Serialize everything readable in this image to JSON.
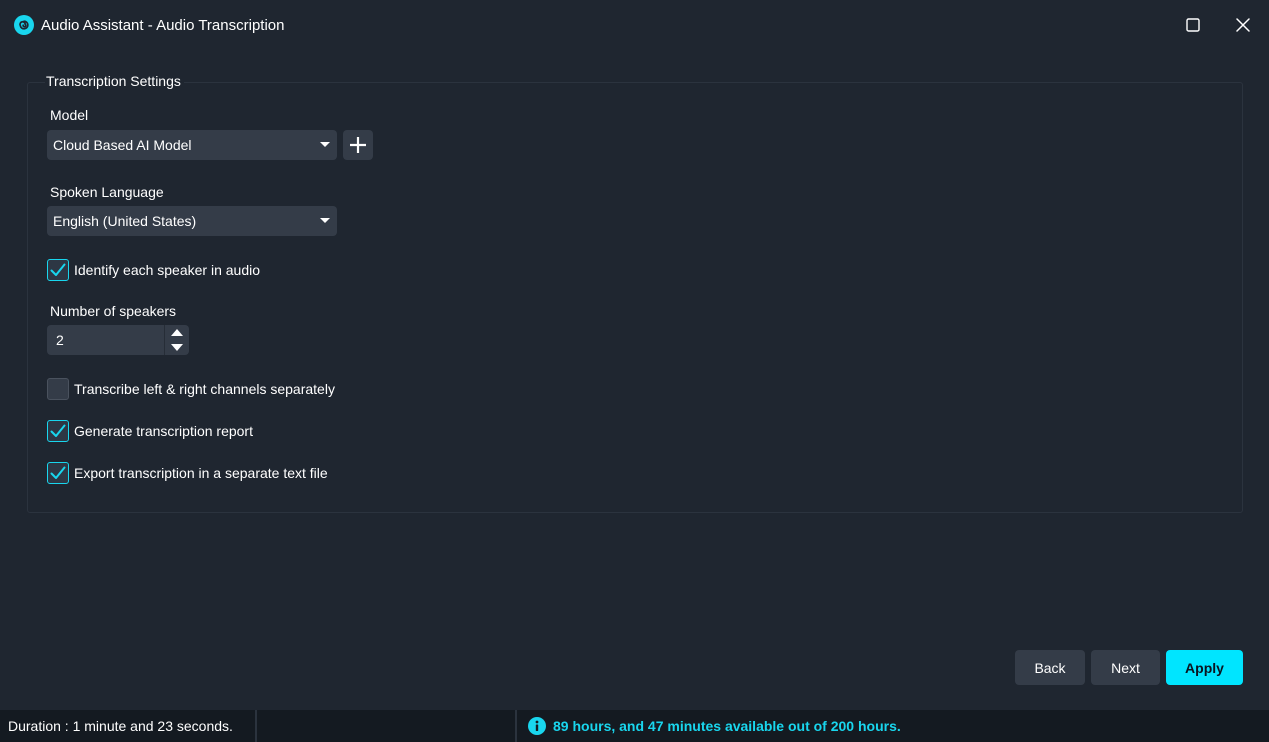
{
  "window": {
    "title": "Audio Assistant - Audio Transcription"
  },
  "settings": {
    "legend": "Transcription Settings",
    "model": {
      "label": "Model",
      "value": "Cloud Based AI Model"
    },
    "language": {
      "label": "Spoken Language",
      "value": "English (United States)"
    },
    "identify_speakers": {
      "label": "Identify each speaker in audio",
      "checked": true
    },
    "speakers": {
      "label": "Number of speakers",
      "value": "2"
    },
    "separate_channels": {
      "label": "Transcribe left & right channels separately",
      "checked": false
    },
    "report": {
      "label": "Generate transcription report",
      "checked": true
    },
    "export": {
      "label": "Export transcription in a separate text file",
      "checked": true
    }
  },
  "footer": {
    "back_label": "Back",
    "next_label": "Next",
    "apply_label": "Apply"
  },
  "status": {
    "duration": "Duration : 1 minute and 23 seconds.",
    "quota": "89 hours, and 47 minutes available out of 200 hours."
  },
  "colors": {
    "accent": "#00e5ff",
    "background": "#1f2630",
    "control": "#343c48",
    "statusbar": "#141a21"
  },
  "icons": {
    "app": "spiral-logo-icon",
    "maximize": "maximize-icon",
    "close": "close-icon",
    "add": "plus-icon",
    "dropdown": "caret-down-icon",
    "check": "checkmark-icon",
    "info": "info-icon"
  }
}
